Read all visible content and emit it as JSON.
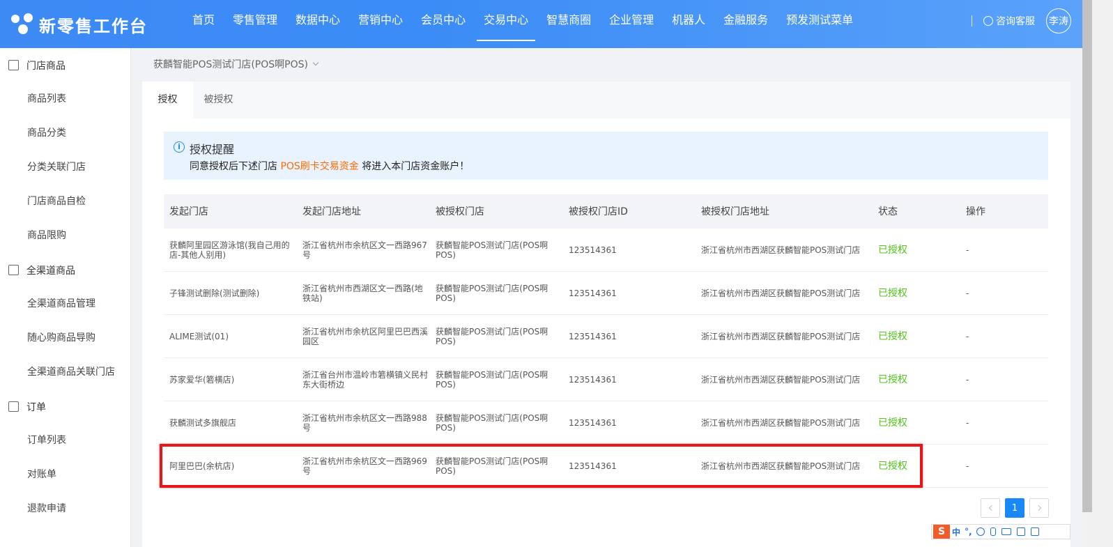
{
  "app": {
    "logo_text": "新零售工作台"
  },
  "nav": {
    "items": [
      "首页",
      "零售管理",
      "数据中心",
      "营销中心",
      "会员中心",
      "交易中心",
      "智慧商圈",
      "企业管理",
      "机器人",
      "金融服务",
      "预发测试菜单"
    ],
    "active": "交易中心"
  },
  "header": {
    "consult_label": "咨询客服",
    "user_name": "李涛"
  },
  "sidebar": {
    "groups": [
      {
        "label": "门店商品",
        "items": [
          "商品列表",
          "商品分类",
          "分类关联门店",
          "门店商品自检",
          "商品限购"
        ]
      },
      {
        "label": "全渠道商品",
        "items": [
          "全渠道商品管理",
          "随心购商品导购",
          "全渠道商品关联门店"
        ]
      },
      {
        "label": "订单",
        "items": [
          "订单列表",
          "对账单",
          "退款申请"
        ]
      }
    ]
  },
  "breadcrumb": {
    "store": "获麟智能POS测试门店(POS啊POS)"
  },
  "tabs": [
    "授权",
    "被授权"
  ],
  "notice": {
    "title": "授权提醒",
    "body_prefix": "同意授权后下述门店 ",
    "body_highlight": "POS刷卡交易资金",
    "body_suffix": " 将进入本门店资金账户！"
  },
  "table": {
    "headers": [
      "发起门店",
      "发起门店地址",
      "被授权门店",
      "被授权门店ID",
      "被授权门店地址",
      "状态",
      "操作"
    ],
    "rows": [
      [
        "获麟阿里园区游泳馆(我自己用的店-其他人别用)",
        "浙江省杭州市余杭区文一西路967号",
        "获麟智能POS测试门店(POS啊POS)",
        "123514361",
        "浙江省杭州市西湖区获麟智能POS测试门店",
        "已授权",
        "-"
      ],
      [
        "子锋测试删除(测试删除)",
        "浙江省杭州市西湖区文一西路(地铁站)",
        "获麟智能POS测试门店(POS啊POS)",
        "123514361",
        "浙江省杭州市西湖区获麟智能POS测试门店",
        "已授权",
        "-"
      ],
      [
        "ALIME测试(01)",
        "浙江省杭州市余杭区阿里巴巴西溪园区",
        "获麟智能POS测试门店(POS啊POS)",
        "123514361",
        "浙江省杭州市西湖区获麟智能POS测试门店",
        "已授权",
        "-"
      ],
      [
        "苏家爱华(箬横店)",
        "浙江省台州市温岭市箬横镇义民村东大街桥边",
        "获麟智能POS测试门店(POS啊POS)",
        "123514361",
        "浙江省杭州市西湖区获麟智能POS测试门店",
        "已授权",
        "-"
      ],
      [
        "获麟测试多旗舰店",
        "浙江省杭州市余杭区文一西路988号",
        "获麟智能POS测试门店(POS啊POS)",
        "123514361",
        "浙江省杭州市西湖区获麟智能POS测试门店",
        "已授权",
        "-"
      ],
      [
        "阿里巴巴(余杭店)",
        "浙江省杭州市余杭区文一西路969号",
        "获麟智能POS测试门店(POS啊POS)",
        "123514361",
        "浙江省杭州市西湖区获麟智能POS测试门店",
        "已授权",
        "-"
      ]
    ]
  },
  "pagination": {
    "current": "1"
  },
  "ime_bar": {
    "lang": "中",
    "punct": "°,"
  }
}
